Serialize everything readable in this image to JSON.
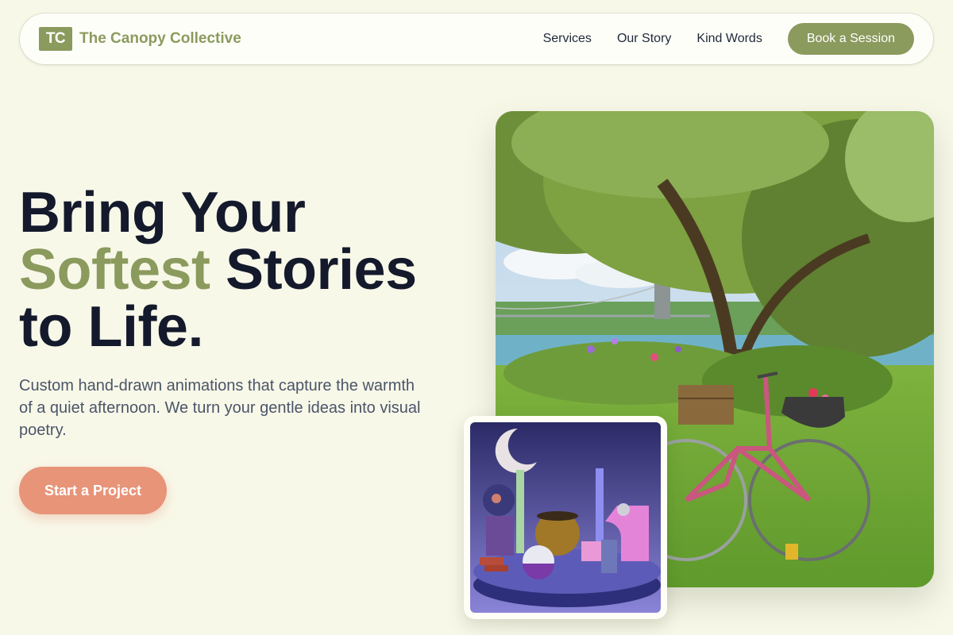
{
  "nav": {
    "logo_initials": "TC",
    "brand_name": "The Canopy Collective",
    "links": [
      {
        "label": "Services"
      },
      {
        "label": "Our Story"
      },
      {
        "label": "Kind Words"
      }
    ],
    "cta_label": "Book a Session"
  },
  "hero": {
    "title_line1": "Bring Your",
    "title_accent": "Softest",
    "title_line2_rest": "Stories",
    "title_line3": "to Life.",
    "description": "Custom hand-drawn animations that capture the warmth of a quiet afternoon. We turn your gentle ideas into visual poetry.",
    "cta_label": "Start a Project"
  },
  "images": {
    "main": "photo: bicycle with flower basket under a willow tree by a river with a suspension bridge",
    "secondary": "3D render: stylized geometric objects on a purple round platform with a crescent moon"
  },
  "colors": {
    "background": "#f8f8e9",
    "accent_green": "#8b9a5d",
    "accent_coral": "#e79479",
    "heading": "#141a2c"
  }
}
